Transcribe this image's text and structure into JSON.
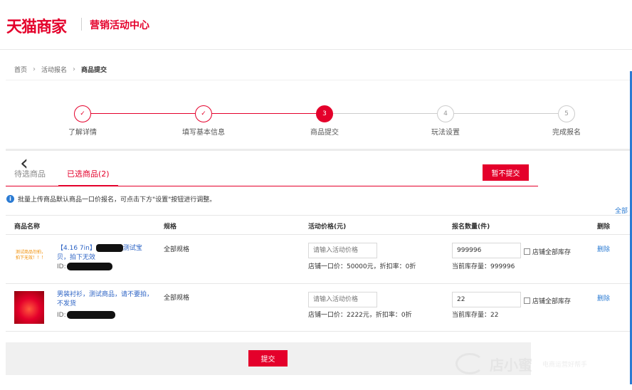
{
  "header": {
    "logo": "天猫商家",
    "subtitle": "营销活动中心"
  },
  "breadcrumb": {
    "items": [
      "首页",
      "活动报名",
      "商品提交"
    ]
  },
  "steps": [
    {
      "index": "✓",
      "label": "了解详情",
      "state": "done"
    },
    {
      "index": "✓",
      "label": "填写基本信息",
      "state": "done"
    },
    {
      "index": "3",
      "label": "商品提交",
      "state": "active"
    },
    {
      "index": "4",
      "label": "玩法设置",
      "state": "todo"
    },
    {
      "index": "5",
      "label": "完成报名",
      "state": "todo"
    }
  ],
  "tabs": {
    "pending": "待选商品",
    "selected": "已选商品(2)",
    "hold_button": "暂不提交"
  },
  "notice": {
    "icon": "i",
    "text": "批量上传商品默认商品一口价报名，可点击下方\"设置\"按钮进行调整。",
    "all_link": "全部"
  },
  "table": {
    "headers": {
      "name": "商品名称",
      "spec": "规格",
      "price": "活动价格(元)",
      "qty": "报名数量(件)",
      "delete": "删除"
    },
    "rows": [
      {
        "thumb_text": "测试商品勿拍，拍下无效！！！",
        "title_prefix": "【4.16 7in】",
        "title_suffix": "测试宝贝，拍下无效",
        "id_label": "ID:",
        "spec": "全部规格",
        "price_placeholder": "请输入活动价格",
        "price_info": "店铺一口价：50000元，折扣率：0折",
        "qty": "999996",
        "stock_check_label": "店铺全部库存",
        "stock_info": "当前库存量：999996",
        "delete": "删除"
      },
      {
        "title": "男装衬衫，测试商品，请不要拍，不发货",
        "id_label": "ID:",
        "spec": "全部规格",
        "price_placeholder": "请输入活动价格",
        "price_info": "店铺一口价：2222元，折扣率：0折",
        "qty": "22",
        "stock_check_label": "店铺全部库存",
        "stock_info": "当前库存量：22",
        "delete": "删除"
      }
    ]
  },
  "footer": {
    "submit": "提交"
  },
  "watermark": {
    "brand": "店小蜜",
    "sub": "电商运营好帮手"
  },
  "colors": {
    "brand": "#e4002b",
    "link": "#2b7bd3"
  }
}
